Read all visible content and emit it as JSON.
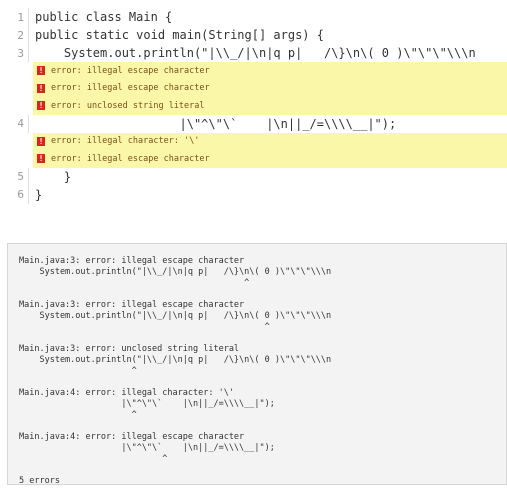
{
  "editor": {
    "lines": [
      {
        "number": "1",
        "code": "public class Main {"
      },
      {
        "number": "2",
        "code": "public static void main(String[] args) {"
      },
      {
        "number": "3",
        "code": "    System.out.println(\"|\\\\_/|\\n|q p|   /\\}\\n\\( 0 )\\\"\\\"\\\"\\\\\\n"
      },
      {
        "number": "4",
        "code": "                    |\\\"^\\\"\\`    |\\n||_/=\\\\\\\\__|\");"
      },
      {
        "number": "5",
        "code": "    }"
      },
      {
        "number": "6",
        "code": "}"
      }
    ],
    "line3_errors": [
      "error: illegal escape character",
      "error: illegal escape character",
      "error: unclosed string literal"
    ],
    "line4_errors": [
      "error: illegal character: '\\'",
      "error: illegal escape character"
    ],
    "error_badge": "!"
  },
  "console": {
    "lines": [
      "Main.java:3: error: illegal escape character",
      "    System.out.println(\"|\\\\_/|\\n|q p|   /\\}\\n\\( 0 )\\\"\\\"\\\"\\\\\\n",
      "                                            ^",
      "",
      "Main.java:3: error: illegal escape character",
      "    System.out.println(\"|\\\\_/|\\n|q p|   /\\}\\n\\( 0 )\\\"\\\"\\\"\\\\\\n",
      "                                                ^",
      "",
      "Main.java:3: error: unclosed string literal",
      "    System.out.println(\"|\\\\_/|\\n|q p|   /\\}\\n\\( 0 )\\\"\\\"\\\"\\\\\\n",
      "                      ^",
      "",
      "Main.java:4: error: illegal character: '\\'",
      "                    |\\\"^\\\"\\`    |\\n||_/=\\\\\\\\__|\");",
      "                      ^",
      "",
      "Main.java:4: error: illegal escape character",
      "                    |\\\"^\\\"\\`    |\\n||_/=\\\\\\\\__|\");",
      "                            ^",
      "",
      "5 errors"
    ]
  },
  "colors": {
    "error_highlight": "#fbf7a8",
    "error_badge": "#d9261c",
    "console_bg": "#f3f3f3"
  }
}
